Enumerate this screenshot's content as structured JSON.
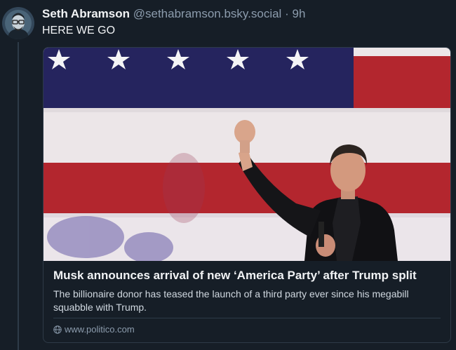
{
  "post": {
    "author_name": "Seth Abramson",
    "author_handle": "@sethabramson.bsky.social",
    "separator": "·",
    "time": "9h",
    "text": "HERE WE GO"
  },
  "link_card": {
    "title": "Musk announces arrival of new ‘America Party’ after Trump split",
    "description": "The billionaire donor has teased the launch of a third party ever since his megabill squabble with Trump.",
    "domain": "www.politico.com",
    "domain_icon": "globe-icon"
  },
  "colors": {
    "background": "#161e27",
    "flag_blue": "#25245e",
    "flag_red": "#b3262e",
    "flag_white": "#ece6e8",
    "muted_text": "#8c9cad"
  }
}
